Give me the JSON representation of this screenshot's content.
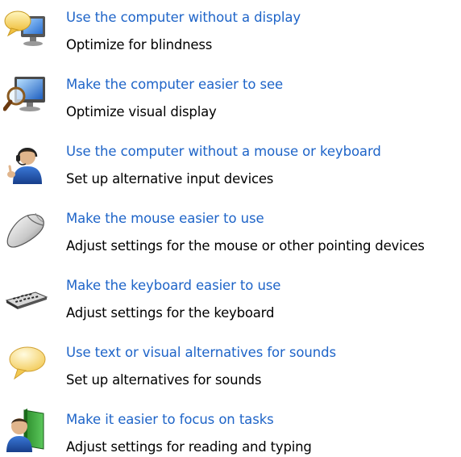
{
  "items": [
    {
      "icon": "speech-bubble-monitor-icon",
      "link": "Use the computer without a display",
      "description": "Optimize for blindness"
    },
    {
      "icon": "magnifier-monitor-icon",
      "link": "Make the computer easier to see",
      "description": "Optimize visual display"
    },
    {
      "icon": "user-headset-icon",
      "link": "Use the computer without a mouse or keyboard",
      "description": "Set up alternative input devices"
    },
    {
      "icon": "mouse-icon",
      "link": "Make the mouse easier to use",
      "description": "Adjust settings for the mouse or other pointing devices"
    },
    {
      "icon": "keyboard-icon",
      "link": "Make the keyboard easier to use",
      "description": "Adjust settings for the keyboard"
    },
    {
      "icon": "speech-bubble-icon",
      "link": "Use text or visual alternatives for sounds",
      "description": "Set up alternatives for sounds"
    },
    {
      "icon": "user-book-icon",
      "link": "Make it easier to focus on tasks",
      "description": "Adjust settings for reading and typing"
    }
  ],
  "colors": {
    "link": "#1e64c8",
    "text": "#000000",
    "background": "#ffffff"
  }
}
